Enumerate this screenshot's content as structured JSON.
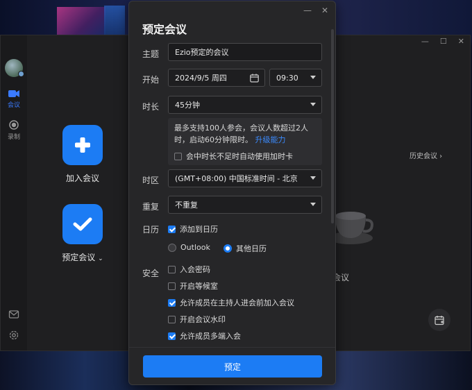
{
  "sidebar": {
    "meeting_label": "会议",
    "record_label": "录制"
  },
  "actions": {
    "join": "加入会议",
    "schedule": "预定会议"
  },
  "main": {
    "history": "历史会议",
    "partial_text": "会议"
  },
  "modal": {
    "title": "预定会议",
    "topic": {
      "label": "主题",
      "value": "Ezio预定的会议"
    },
    "start": {
      "label": "开始",
      "date": "2024/9/5 周四",
      "time": "09:30"
    },
    "duration": {
      "label": "时长",
      "value": "45分钟",
      "notice_text": "最多支持100人参会，会议人数超过2人时，启动60分钟限时。",
      "notice_link": "升级能力",
      "auto_card_label": "会中时长不足时自动使用加时卡"
    },
    "timezone": {
      "label": "时区",
      "value": "(GMT+08:00) 中国标准时间 - 北京"
    },
    "repeat": {
      "label": "重复",
      "value": "不重复"
    },
    "calendar": {
      "label": "日历",
      "add_label": "添加到日历",
      "option_outlook": "Outlook",
      "option_other": "其他日历"
    },
    "security": {
      "label": "安全",
      "items": [
        {
          "label": "入会密码",
          "checked": false
        },
        {
          "label": "开启等候室",
          "checked": false
        },
        {
          "label": "允许成员在主持人进会前加入会议",
          "checked": true
        },
        {
          "label": "开启会议水印",
          "checked": false
        },
        {
          "label": "允许成员多端入会",
          "checked": true
        }
      ]
    },
    "submit_label": "预定"
  },
  "colors": {
    "accent": "#1c7cf4",
    "link": "#3b8bff",
    "modal_bg": "#262628",
    "app_bg": "#1f1f21"
  }
}
